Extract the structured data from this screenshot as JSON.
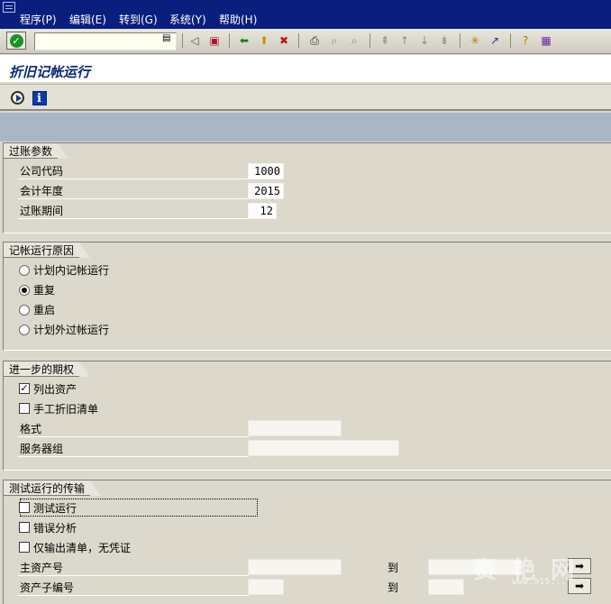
{
  "menu": {
    "items": [
      "程序(P)",
      "编辑(E)",
      "转到(G)",
      "系统(Y)",
      "帮助(H)"
    ]
  },
  "toolbar": {
    "command_field_value": ""
  },
  "title": "折旧记帐运行",
  "groups": {
    "posting_params": {
      "title": "过账参数",
      "company_code_label": "公司代码",
      "company_code_value": "1000",
      "fiscal_year_label": "会计年度",
      "fiscal_year_value": "2015",
      "posting_period_label": "过账期间",
      "posting_period_value": "12"
    },
    "run_reason": {
      "title": "记帐运行原因",
      "options": [
        "计划内记帐运行",
        "重复",
        "重启",
        "计划外过帐运行"
      ],
      "selected": "重复"
    },
    "further_options": {
      "title": "进一步的期权",
      "list_assets_label": "列出资产",
      "list_assets_checked": true,
      "manual_dep_label": "手工折旧清单",
      "manual_dep_checked": false,
      "format_label": "格式",
      "format_value": "",
      "server_group_label": "服务器组",
      "server_group_value": ""
    },
    "test_run": {
      "title": "测试运行的传输",
      "test_run_label": "测试运行",
      "test_run_checked": false,
      "error_analysis_label": "错误分析",
      "error_analysis_checked": false,
      "list_only_label": "仅输出清单，无凭证",
      "list_only_checked": false,
      "main_asset_label": "主资产号",
      "main_asset_from": "",
      "main_asset_to_label": "到",
      "main_asset_to": "",
      "sub_asset_label": "资产子编号",
      "sub_asset_from": "",
      "sub_asset_to_label": "到",
      "sub_asset_to": ""
    }
  },
  "watermark": {
    "text": "赛 艳 网",
    "sub": "www.915..."
  },
  "colors": {
    "menubar": "#0a1e7e",
    "title_text": "#0c2a7a",
    "background": "#dcd8cc",
    "band": "#a8b6c6"
  }
}
